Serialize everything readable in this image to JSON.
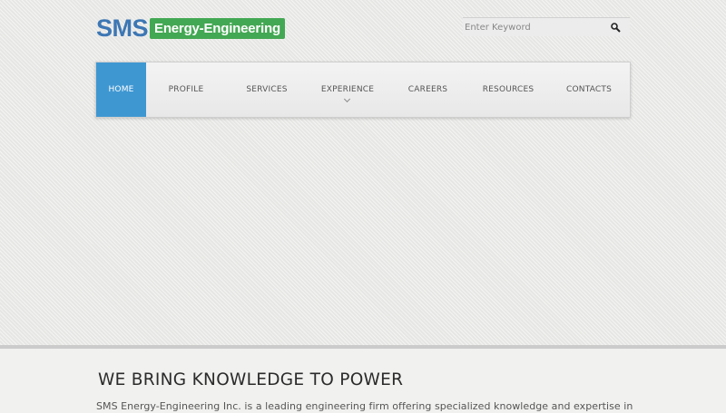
{
  "header": {
    "logo": {
      "primary": "SMS",
      "secondary": "Energy-Engineering"
    },
    "search": {
      "placeholder": "Enter Keyword",
      "button_icon": "search-icon"
    }
  },
  "nav": {
    "items": [
      {
        "label": "HOME",
        "active": true
      },
      {
        "label": "PROFILE"
      },
      {
        "label": "SERVICES"
      },
      {
        "label": "EXPERIENCE",
        "has_dropdown": true
      },
      {
        "label": "CAREERS"
      },
      {
        "label": "RESOURCES"
      },
      {
        "label": "CONTACTS"
      }
    ]
  },
  "main": {
    "headline": "WE BRING KNOWLEDGE TO POWER",
    "intro": "SMS Energy-Engineering Inc. is a leading engineering firm offering specialized knowledge and expertise in"
  },
  "colors": {
    "logo_blue": "#3d77b4",
    "logo_green": "#43a853",
    "nav_active": "#3f97d2",
    "page_background": "#e6e6e4"
  }
}
